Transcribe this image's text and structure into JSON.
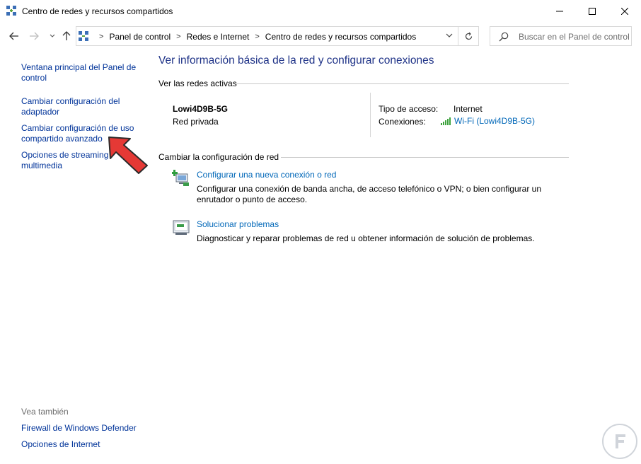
{
  "window": {
    "title": "Centro de redes y recursos compartidos",
    "minimize_icon": "minimize-icon",
    "maximize_icon": "maximize-icon",
    "close_icon": "close-icon"
  },
  "nav": {
    "breadcrumbs": [
      "Panel de control",
      "Redes e Internet",
      "Centro de redes y recursos compartidos"
    ],
    "search_placeholder": "Buscar en el Panel de control"
  },
  "left_pane": {
    "links": [
      {
        "line1": "Ventana principal del Panel de",
        "line2": "control"
      },
      {
        "line1": "Cambiar configuración del",
        "line2": "adaptador"
      },
      {
        "line1": "Cambiar configuración de uso",
        "line2": "compartido avanzado"
      },
      {
        "line1": "Opciones de streaming",
        "line2": "multimedia"
      }
    ],
    "see_also_label": "Vea también",
    "see_also_links": [
      "Firewall de Windows Defender",
      "Opciones de Internet"
    ]
  },
  "main": {
    "title": "Ver información básica de la red y configurar conexiones",
    "active_networks_label": "Ver las redes activas",
    "network": {
      "name": "Lowi4D9B-5G",
      "category": "Red privada",
      "access_type_label": "Tipo de acceso:",
      "access_type_value": "Internet",
      "connections_label": "Conexiones:",
      "connection_link": "Wi-Fi (Lowi4D9B-5G)"
    },
    "change_settings_label": "Cambiar la configuración de red",
    "tasks": [
      {
        "link": "Configurar una nueva conexión o red",
        "desc_line1": "Configurar una conexión de banda ancha, de acceso telefónico o VPN; o bien configurar un",
        "desc_line2": "enrutador o punto de acceso."
      },
      {
        "link": "Solucionar problemas",
        "desc_line1": "Diagnosticar y reparar problemas de red u obtener información de solución de problemas.",
        "desc_line2": ""
      }
    ]
  },
  "colors": {
    "link_left": "#003399",
    "link_main": "#0067b8",
    "title_blue": "#1e3287",
    "arrow_red": "#e53935"
  }
}
